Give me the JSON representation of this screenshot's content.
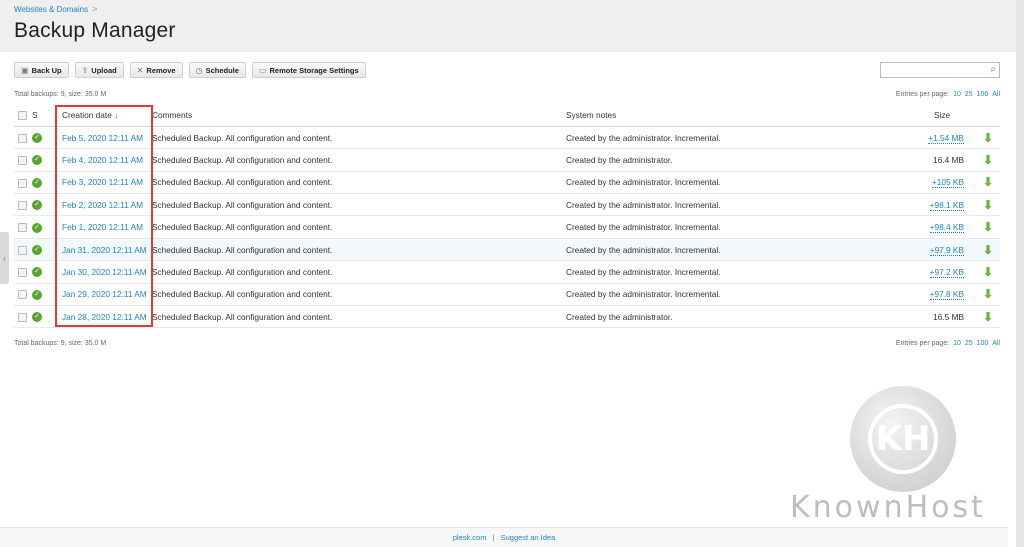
{
  "breadcrumb": {
    "link": "Websites & Domains",
    "sep": ">"
  },
  "page_title": "Backup Manager",
  "toolbar": {
    "back_up": "Back Up",
    "upload": "Upload",
    "remove": "Remove",
    "schedule": "Schedule",
    "remote_storage": "Remote Storage Settings"
  },
  "search": {
    "value": "",
    "placeholder": ""
  },
  "summary": "Total backups: 9, size: 35.0 M",
  "per_page": {
    "label": "Entries per page:",
    "o10": "10",
    "o25": "25",
    "o100": "100",
    "all": "All"
  },
  "table": {
    "headers": {
      "s": "S",
      "creation_date": "Creation date",
      "sort_arrow": "↓",
      "comments": "Comments",
      "system_notes": "System notes",
      "size": "Size"
    },
    "rows": [
      {
        "date": "Feb 5, 2020 12:11 AM",
        "comment": "Scheduled Backup. All configuration and content.",
        "notes": "Created by the administrator. Incremental.",
        "size": "+1.54 MB"
      },
      {
        "date": "Feb 4, 2020 12:11 AM",
        "comment": "Scheduled Backup. All configuration and content.",
        "notes": "Created by the administrator.",
        "size": "16.4 MB"
      },
      {
        "date": "Feb 3, 2020 12:11 AM",
        "comment": "Scheduled Backup. All configuration and content.",
        "notes": "Created by the administrator. Incremental.",
        "size": "+105 KB"
      },
      {
        "date": "Feb 2, 2020 12:11 AM",
        "comment": "Scheduled Backup. All configuration and content.",
        "notes": "Created by the administrator. Incremental.",
        "size": "+98.1 KB"
      },
      {
        "date": "Feb 1, 2020 12:11 AM",
        "comment": "Scheduled Backup. All configuration and content.",
        "notes": "Created by the administrator. Incremental.",
        "size": "+98.4 KB"
      },
      {
        "date": "Jan 31, 2020 12:11 AM",
        "comment": "Scheduled Backup. All configuration and content.",
        "notes": "Created by the administrator. Incremental.",
        "size": "+97.9 KB"
      },
      {
        "date": "Jan 30, 2020 12:11 AM",
        "comment": "Scheduled Backup. All configuration and content.",
        "notes": "Created by the administrator. Incremental.",
        "size": "+97.2 KB"
      },
      {
        "date": "Jan 29, 2020 12:11 AM",
        "comment": "Scheduled Backup. All configuration and content.",
        "notes": "Created by the administrator. Incremental.",
        "size": "+97.8 KB"
      },
      {
        "date": "Jan 28, 2020 12:11 AM",
        "comment": "Scheduled Backup. All configuration and content.",
        "notes": "Created by the administrator.",
        "size": "16.5 MB"
      }
    ]
  },
  "footer": {
    "plesk": "plesk.com",
    "separator": "|",
    "suggest": "Suggest an Idea"
  },
  "watermark": {
    "monogram": "KH",
    "text": "KnownHost"
  },
  "colors": {
    "link": "#1f85c5",
    "status_ok": "#5aa42c",
    "download": "#6cb33f",
    "highlight_box": "#e03a3a"
  }
}
